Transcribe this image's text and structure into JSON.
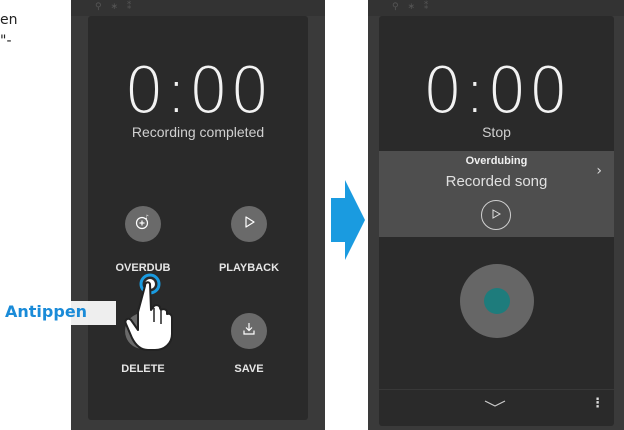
{
  "instruction": {
    "line1": "en",
    "line2": "\"-"
  },
  "left_screen": {
    "time": "0:00",
    "status": "Recording completed",
    "buttons": [
      {
        "id": "overdub",
        "label": "OVERDUB",
        "icon": "overdub-icon"
      },
      {
        "id": "playback",
        "label": "PLAYBACK",
        "icon": "play-icon"
      },
      {
        "id": "delete",
        "label": "DELETE",
        "icon": "trash-icon"
      },
      {
        "id": "save",
        "label": "SAVE",
        "icon": "save-icon"
      }
    ]
  },
  "callout": {
    "text": "Antippen",
    "color": "#1a8bd8"
  },
  "right_screen": {
    "time": "0:00",
    "status": "Stop",
    "track": {
      "mode": "Overdubing",
      "name": "Recorded song"
    },
    "record_color": "#1e7c7c"
  },
  "colors": {
    "arrow": "#1a9be0",
    "panel": "#2a2a2a",
    "button": "#6a6a6a"
  }
}
